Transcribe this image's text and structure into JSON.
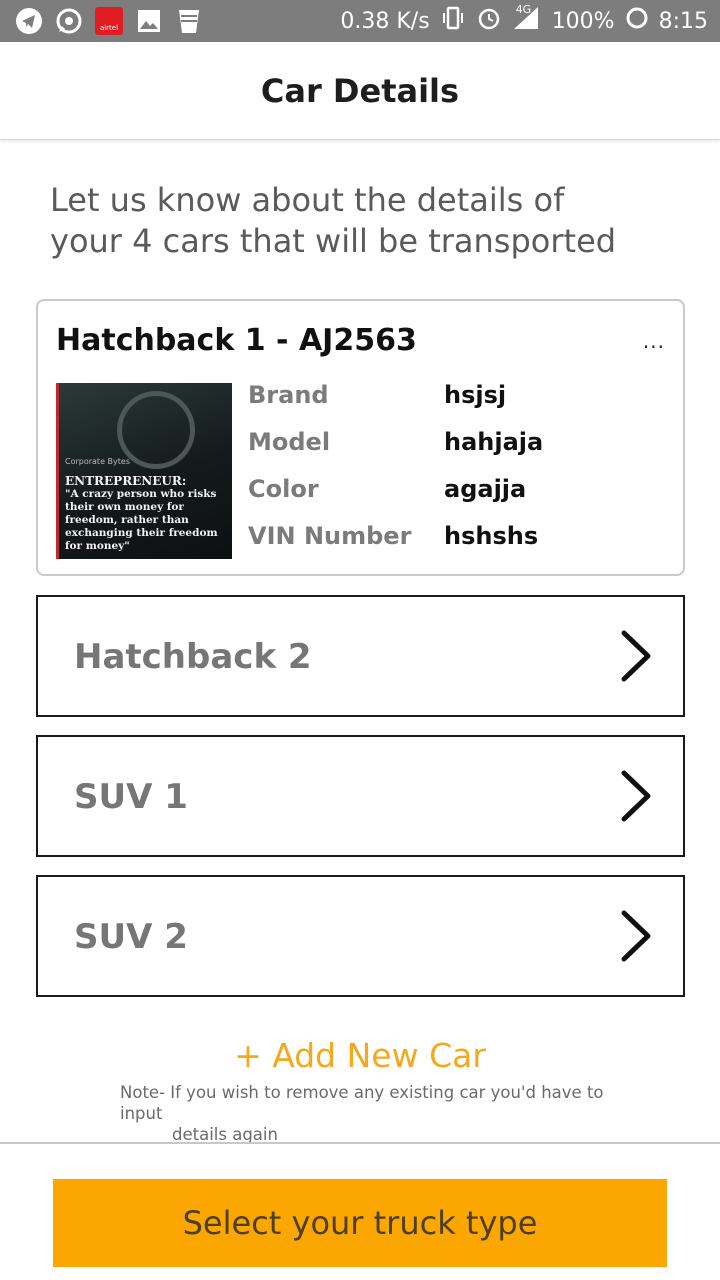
{
  "status_bar": {
    "speed": "0.38 K/s",
    "battery": "100%",
    "time": "8:15",
    "network": "4G",
    "carrier_label": "airtel"
  },
  "header": {
    "title": "Car Details"
  },
  "intro": {
    "line1": "Let us know about the details of",
    "line2": "your 4 cars that will be transported"
  },
  "expanded_car": {
    "title": "Hatchback 1 - AJ2563",
    "more": "...",
    "thumbnail_text": {
      "brand": "Corporate Bytes",
      "heading": "ENTREPRENEUR:",
      "quote": "\"A crazy person who risks their own money for freedom, rather than exchanging their freedom for money\""
    },
    "details": [
      {
        "label": "Brand",
        "value": "hsjsj"
      },
      {
        "label": "Model",
        "value": "hahjaja"
      },
      {
        "label": "Color",
        "value": "agajja"
      },
      {
        "label": "VIN Number",
        "value": "hshshs"
      }
    ]
  },
  "cars": [
    {
      "name": "Hatchback 2"
    },
    {
      "name": "SUV 1"
    },
    {
      "name": "SUV 2"
    }
  ],
  "add_car_label": "+ Add New Car",
  "note": {
    "line1": "Note- If you wish to remove any existing car you'd have to input",
    "line2": "details again"
  },
  "cta_label": "Select your truck type",
  "colors": {
    "accent": "#fca600",
    "add_link": "#f4a81d",
    "status_bar": "#7d7d7d"
  }
}
